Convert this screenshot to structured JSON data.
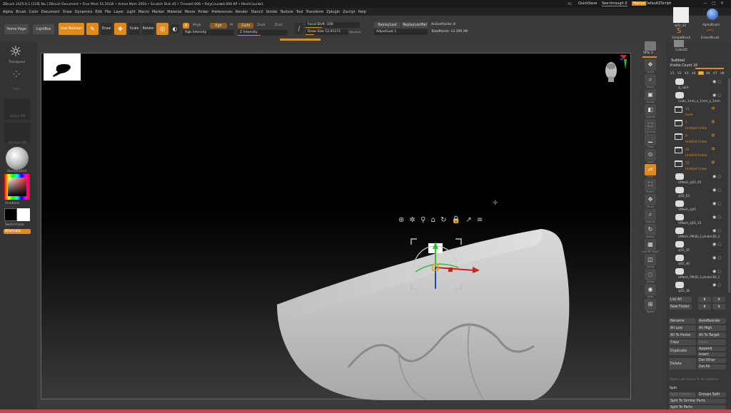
{
  "titlebar": {
    "title": "ZBrush 2025.0.1 [23号 No.]  ZBrush Document   • Free Mem 51.55GB • Active Mem 3504 • Scratch Disk 45 • Timer▸0.006 • PolyCount▸0.006 KP • MeshCount▸1",
    "ac": "AC",
    "quicksave": "QuickSave",
    "seethrough": "See-through  0",
    "menus": "Menus",
    "default_zscript": "DefaultZScript"
  },
  "menubar": [
    "Alpha",
    "Brush",
    "Color",
    "Document",
    "Draw",
    "Dynamics",
    "Edit",
    "File",
    "Layer",
    "Light",
    "Macro",
    "Marker",
    "Material",
    "Movie",
    "Picker",
    "Preferences",
    "Render",
    "Stencil",
    "Stroke",
    "Texture",
    "Tool",
    "Transform",
    "Zplugin",
    "Zscript",
    "Help"
  ],
  "topshelf": {
    "home_page": "Home Page",
    "lightbox": "LightBox",
    "live_boolean": "Live Boolean",
    "edit": "Edit",
    "draw": "Draw",
    "move": "Move",
    "scale": "Scale",
    "rotate": "Rotate",
    "a_label": "A",
    "mrgb": "Mrgb",
    "rgb": "Rgb",
    "m": "M",
    "zadd": "Zadd",
    "zsub": "Zsub",
    "zcut": "Zcut",
    "rgb_intensity": "Rgb Intensity",
    "z_intensity": "Z Intensity",
    "focal_shift": "Focal Shift -100",
    "draw_size": "Draw Size 12.91171",
    "dynamic": "Dynamic",
    "replay_last": "ReplayLast",
    "replay_last_rel": "ReplayLastRel",
    "adjust_last": "AdjustLast 1",
    "active_points": "ActivePoints: 8",
    "total_points": "TotalPoints: 12.295 Mil"
  },
  "leftshelf": {
    "transpose": "Transpose",
    "dots": "Dots",
    "alpha_off": "Alpha Off",
    "texture_off": "Texture Off",
    "skin_shade": "SkinShade4",
    "gradient": "Gradient",
    "switch_color": "SwitchColor",
    "alternate": "Alternate"
  },
  "rightshelf": {
    "spix": "SPix 3",
    "items": [
      "Scroll",
      "Zoom",
      "Actual",
      "AAHalf",
      "Dynamic Persp",
      "Floor",
      "Local",
      "Sym",
      "Frame",
      "Move",
      "ZoomD",
      "Rotate",
      "Line Fill PolyF",
      "Transp",
      "Ghost",
      "Solo",
      "Xpose"
    ]
  },
  "tray": {
    "brushes": [
      "sj02_43",
      "AlphaBrush",
      "SimpleBrush",
      "EraserBrush",
      "Cube3D"
    ],
    "subtool_title": "Subtool",
    "visible_count": "Visible Count 16",
    "v_tabs": [
      "V1",
      "V2",
      "V3",
      "V4",
      "V5",
      "V6",
      "V7",
      "V8"
    ],
    "active_v": 4,
    "entries": [
      {
        "name": "sj_split",
        "type": "mesh",
        "orange": false
      },
      {
        "name": "Cube_1mm_x_1mm_x_1mm",
        "type": "mesh",
        "orange": false
      },
      {
        "name": "13",
        "sub": "head",
        "type": "folder",
        "orange": true
      },
      {
        "name": "7",
        "sub": "Untitled Folder",
        "type": "folder",
        "orange": true
      },
      {
        "name": "9",
        "sub": "Untitled Folder",
        "type": "folder",
        "orange": true
      },
      {
        "name": "20",
        "sub": "Untitled Folder",
        "type": "folder",
        "orange": true
      },
      {
        "name": "25",
        "sub": "Untitled Folder",
        "type": "folder",
        "orange": true
      },
      {
        "name": "UMesh_sj02_05",
        "type": "mesh",
        "orange": false
      },
      {
        "name": "sj02_03",
        "type": "mesh",
        "orange": false
      },
      {
        "name": "UMesh_sj05",
        "type": "mesh",
        "orange": false
      },
      {
        "name": "UMesh_sj02_15",
        "type": "mesh",
        "orange": false
      },
      {
        "name": "UMesh_PM3D_Cylinder3D_2",
        "type": "mesh",
        "orange": false
      },
      {
        "name": "sj02_35",
        "type": "mesh",
        "orange": false
      },
      {
        "name": "sj02_40",
        "type": "mesh",
        "orange": false
      },
      {
        "name": "UMesh_PM3D_Cylinder3D_1",
        "type": "mesh",
        "orange": false
      },
      {
        "name": "sj02_38",
        "type": "mesh",
        "orange": false
      }
    ],
    "list_all": "List All",
    "new_folder": "New Folder",
    "rename": "Rename",
    "auto_reorder": "AutoReorder",
    "all_low": "All Low",
    "all_high": "All High",
    "all_to_home": "All To Home",
    "all_to_target": "All To Target",
    "copy": "Copy",
    "paste": "Paste",
    "duplicate": "Duplicate",
    "append": "Append",
    "insert": "Insert",
    "delete": "Delete",
    "del_other": "Del Other",
    "del_all": "Del All",
    "apply_note": "Apply Last Action To All Subtools",
    "split_title": "Split",
    "split_hidden": "Split Hidden",
    "groups_split": "Groups Split",
    "split_similar": "Split To Similar Parts",
    "split_parts": "Split To Parts"
  },
  "canvas": {
    "gizmo_label": "⊕ ✲ ⚲ ⌂ ↻ 🔒 ↗ ≡"
  }
}
